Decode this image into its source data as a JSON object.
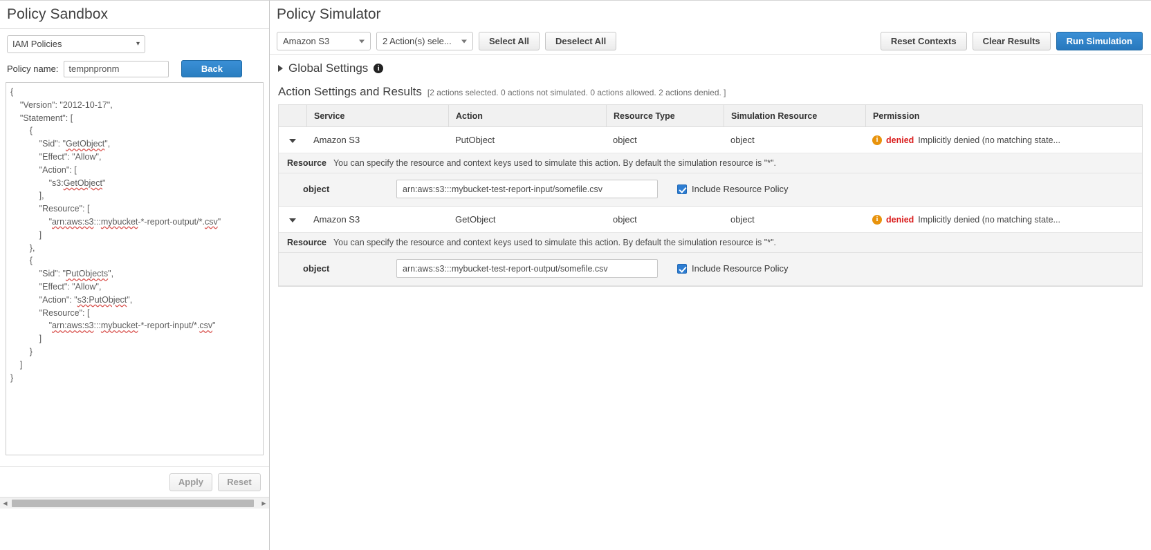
{
  "left": {
    "title": "Policy Sandbox",
    "policy_source_select": {
      "value": "IAM Policies",
      "chevron": "chevron-down-icon"
    },
    "policy_name_label": "Policy name:",
    "policy_name_value": "tempnpronm",
    "back_label": "Back",
    "policy_json": "{\n    \"Version\": \"2012-10-17\",\n    \"Statement\": [\n        {\n            \"Sid\": \"GetObject\",\n            \"Effect\": \"Allow\",\n            \"Action\": [\n                \"s3:GetObject\"\n            ],\n            \"Resource\": [\n                \"arn:aws:s3:::mybucket-*-report-output/*.csv\"\n            ]\n        },\n        {\n            \"Sid\": \"PutObjects\",\n            \"Effect\": \"Allow\",\n            \"Action\": \"s3:PutObject\",\n            \"Resource\": [\n                \"arn:aws:s3:::mybucket-*-report-input/*.csv\"\n            ]\n        }\n    ]\n}",
    "apply_label": "Apply",
    "reset_label": "Reset"
  },
  "right": {
    "title": "Policy Simulator",
    "toolbar": {
      "service_select": "Amazon S3",
      "action_select": "2 Action(s) sele...",
      "select_all": "Select All",
      "deselect_all": "Deselect All",
      "reset_contexts": "Reset Contexts",
      "clear_results": "Clear Results",
      "run_simulation": "Run Simulation"
    },
    "global_settings": {
      "label": "Global Settings",
      "info_glyph": "i"
    },
    "action_settings": {
      "title": "Action Settings and Results",
      "summary": "[2 actions selected. 0 actions not simulated. 0 actions allowed. 2 actions denied. ]"
    },
    "table": {
      "columns": [
        "",
        "Service",
        "Action",
        "Resource Type",
        "Simulation Resource",
        "Permission"
      ],
      "rows": [
        {
          "service": "Amazon S3",
          "action": "PutObject",
          "resource_type": "object",
          "simulation_resource": "object",
          "permission_badge": "denied",
          "permission_message": "Implicitly denied (no matching state...",
          "resource_panel": {
            "label": "Resource",
            "description": "You can specify the resource and context keys used to simulate this action. By default the simulation resource is \"*\".",
            "key": "object",
            "value": "arn:aws:s3:::mybucket-test-report-input/somefile.csv",
            "include_policy_label": "Include Resource Policy",
            "include_policy_checked": true
          }
        },
        {
          "service": "Amazon S3",
          "action": "GetObject",
          "resource_type": "object",
          "simulation_resource": "object",
          "permission_badge": "denied",
          "permission_message": "Implicitly denied (no matching state...",
          "resource_panel": {
            "label": "Resource",
            "description": "You can specify the resource and context keys used to simulate this action. By default the simulation resource is \"*\".",
            "key": "object",
            "value": "arn:aws:s3:::mybucket-test-report-output/somefile.csv",
            "include_policy_label": "Include Resource Policy",
            "include_policy_checked": true
          }
        }
      ]
    }
  },
  "colors": {
    "primary_blue": "#2878bd",
    "denied_red": "#d91b1b",
    "warn_orange": "#e8930c",
    "panel_gray": "#f4f4f4"
  }
}
